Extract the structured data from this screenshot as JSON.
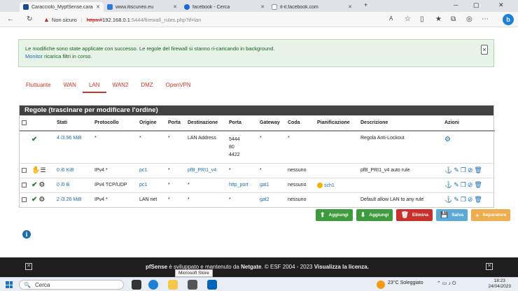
{
  "browser": {
    "tabs": [
      {
        "title": "Caracciolo_MypfSense.caracciolo",
        "active": true
      },
      {
        "title": "www.itiscuneo.eu",
        "active": false
      },
      {
        "title": "facebook - Cerca",
        "active": false
      },
      {
        "title": "it-it.facebook.com",
        "active": false
      }
    ],
    "address": {
      "security": "Non sicuro",
      "scheme": "https://",
      "host": "192.168.0.1",
      "port_path": ":5444/firewall_rules.php?if=lan"
    }
  },
  "alert": {
    "line1": "Le modifiche sono state applicate con successo. Le regole del firewall si stanno ri-caricando in background.",
    "link": "Monitor",
    "line2_rest": " ricarica filtri in corso.",
    "close": "×"
  },
  "nav_tabs": [
    "Fluttuante",
    "WAN",
    "LAN",
    "WAN2",
    "DMZ",
    "OpenVPN"
  ],
  "active_tab": "LAN",
  "panel": {
    "title": "Regole (trascinare per modificare l'ordine)",
    "headers": [
      "",
      "",
      "Stati",
      "Protocollo",
      "Origine",
      "Porta",
      "Destinazione",
      "Porta",
      "Gateway",
      "Coda",
      "Pianificazione",
      "Descrizione",
      "Azioni"
    ],
    "rows": [
      {
        "states": "4 /3.96 MiB",
        "protocol": "*",
        "source": "*",
        "sport": "*",
        "dest": "LAN Address",
        "dport": "5444\n80\n4422",
        "gateway": "*",
        "queue": "*",
        "schedule": "",
        "desc": "Regola Anti-Lockout"
      },
      {
        "states": "0 /6 KiB",
        "protocol": "IPv4 *",
        "source": "pc1",
        "sport": "*",
        "dest": "pfB_PRI1_v4",
        "dport": "*",
        "gateway": "*",
        "queue": "nessuno",
        "schedule": "",
        "desc": "pfB_PRI1_v4 auto rule"
      },
      {
        "states": "0 /0 B",
        "protocol": "IPv4 TCP/UDP",
        "source": "pc1",
        "sport": "*",
        "dest": "*",
        "dport": "http_port",
        "gateway": "gat1",
        "queue": "nessuno",
        "schedule": "sch1",
        "desc": ""
      },
      {
        "states": "2 /3.26 MiB",
        "protocol": "IPv4 *",
        "source": "LAN net",
        "sport": "*",
        "dest": "*",
        "dport": "*",
        "gateway": "gat2",
        "queue": "nessuno",
        "schedule": "",
        "desc": "Default allow LAN to any rule"
      }
    ]
  },
  "buttons": {
    "add_top": "Aggiungi",
    "add_bottom": "Aggiungi",
    "delete": "Elimina",
    "save": "Salva",
    "separator": "Separatore"
  },
  "footer": {
    "brand": "pfSense",
    "text1": " è sviluppato e mantenuto da ",
    "netgate": "Netgate",
    "text2": ". © ESF 2004 - 2023 ",
    "license": "Visualizza la licenza.",
    "tooltip": "Microsoft Store"
  },
  "taskbar": {
    "search": "Cerca",
    "weather": "23°C  Soleggiato",
    "time": "18:23",
    "date": "24/04/2023"
  }
}
